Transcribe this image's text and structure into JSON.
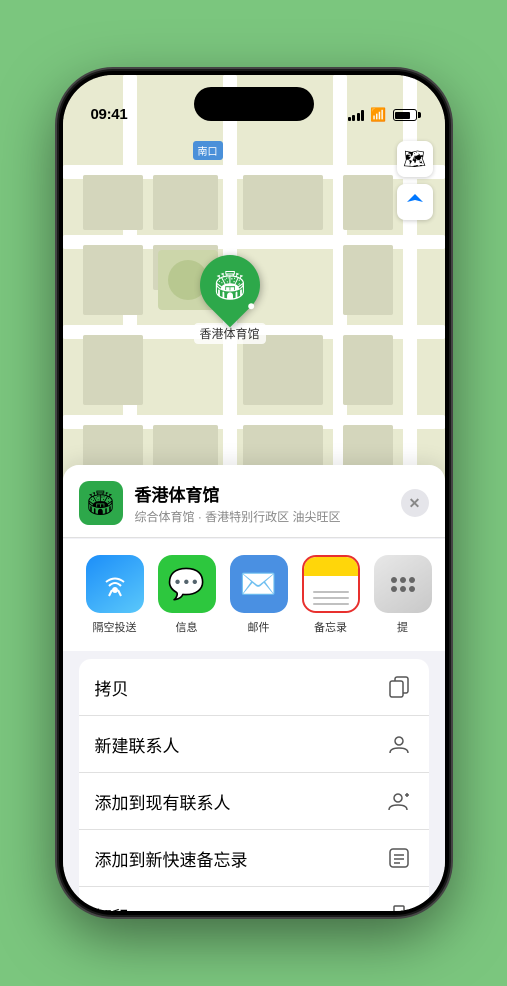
{
  "status_bar": {
    "time": "09:41",
    "location_arrow": "▲"
  },
  "map": {
    "label_text": "南口",
    "map_type_icon": "🗺",
    "location_icon": "◎"
  },
  "venue": {
    "name": "香港体育馆",
    "description": "综合体育馆 · 香港特别行政区 油尖旺区",
    "pin_emoji": "🏟"
  },
  "share_items": [
    {
      "id": "airdrop",
      "label": "隔空投送"
    },
    {
      "id": "messages",
      "label": "信息"
    },
    {
      "id": "mail",
      "label": "邮件"
    },
    {
      "id": "notes",
      "label": "备忘录"
    },
    {
      "id": "more",
      "label": "提"
    }
  ],
  "menu_items": [
    {
      "id": "copy",
      "label": "拷贝"
    },
    {
      "id": "new-contact",
      "label": "新建联系人"
    },
    {
      "id": "add-existing",
      "label": "添加到现有联系人"
    },
    {
      "id": "add-quick-note",
      "label": "添加到新快速备忘录"
    },
    {
      "id": "print",
      "label": "打印"
    }
  ],
  "icons": {
    "close": "✕",
    "copy": "⧉",
    "new_contact": "👤",
    "add_contact": "👤",
    "quick_note": "⊡",
    "print": "🖨"
  },
  "colors": {
    "green": "#2da84a",
    "blue": "#4a90e2",
    "red": "#e8302e",
    "notes_yellow": "#ffd60a"
  }
}
